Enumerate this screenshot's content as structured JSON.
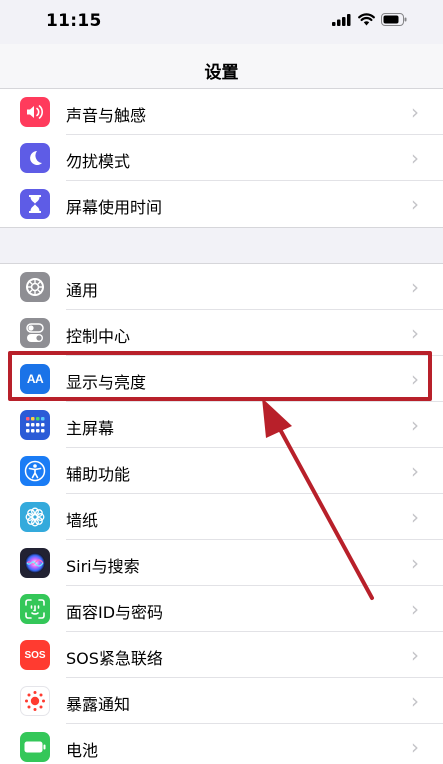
{
  "status_bar": {
    "time": "11:15"
  },
  "nav": {
    "title": "设置"
  },
  "group1": [
    {
      "label": "声音与触感",
      "icon": "speaker-icon",
      "color": "#ff3b5c"
    },
    {
      "label": "勿扰模式",
      "icon": "moon-icon",
      "color": "#5e5ce6"
    },
    {
      "label": "屏幕使用时间",
      "icon": "hourglass-icon",
      "color": "#5e5ce6"
    }
  ],
  "group2": [
    {
      "label": "通用",
      "icon": "gear-icon",
      "color": "#8e8e93"
    },
    {
      "label": "控制中心",
      "icon": "toggle-icon",
      "color": "#8e8e93"
    },
    {
      "label": "显示与亮度",
      "icon": "text-size-icon",
      "color": "#1a73e8",
      "icon_text": "AA"
    },
    {
      "label": "主屏幕",
      "icon": "grid-icon",
      "color": "#2b5bd7"
    },
    {
      "label": "辅助功能",
      "icon": "accessibility-icon",
      "color": "#1a7cf5"
    },
    {
      "label": "墙纸",
      "icon": "flower-icon",
      "color": "#34aadc"
    },
    {
      "label": "Siri与搜索",
      "icon": "siri-icon",
      "color": "#222233"
    },
    {
      "label": "面容ID与密码",
      "icon": "face-id-icon",
      "color": "#34c759"
    },
    {
      "label": "SOS紧急联络",
      "icon": "sos-icon",
      "color": "#ff3b30",
      "icon_text": "SOS"
    },
    {
      "label": "暴露通知",
      "icon": "exposure-icon",
      "color": "#ffffff"
    },
    {
      "label": "电池",
      "icon": "battery-icon",
      "color": "#34c759"
    }
  ],
  "chevron": "›",
  "annotation": {
    "highlight_color": "#b8202a"
  }
}
